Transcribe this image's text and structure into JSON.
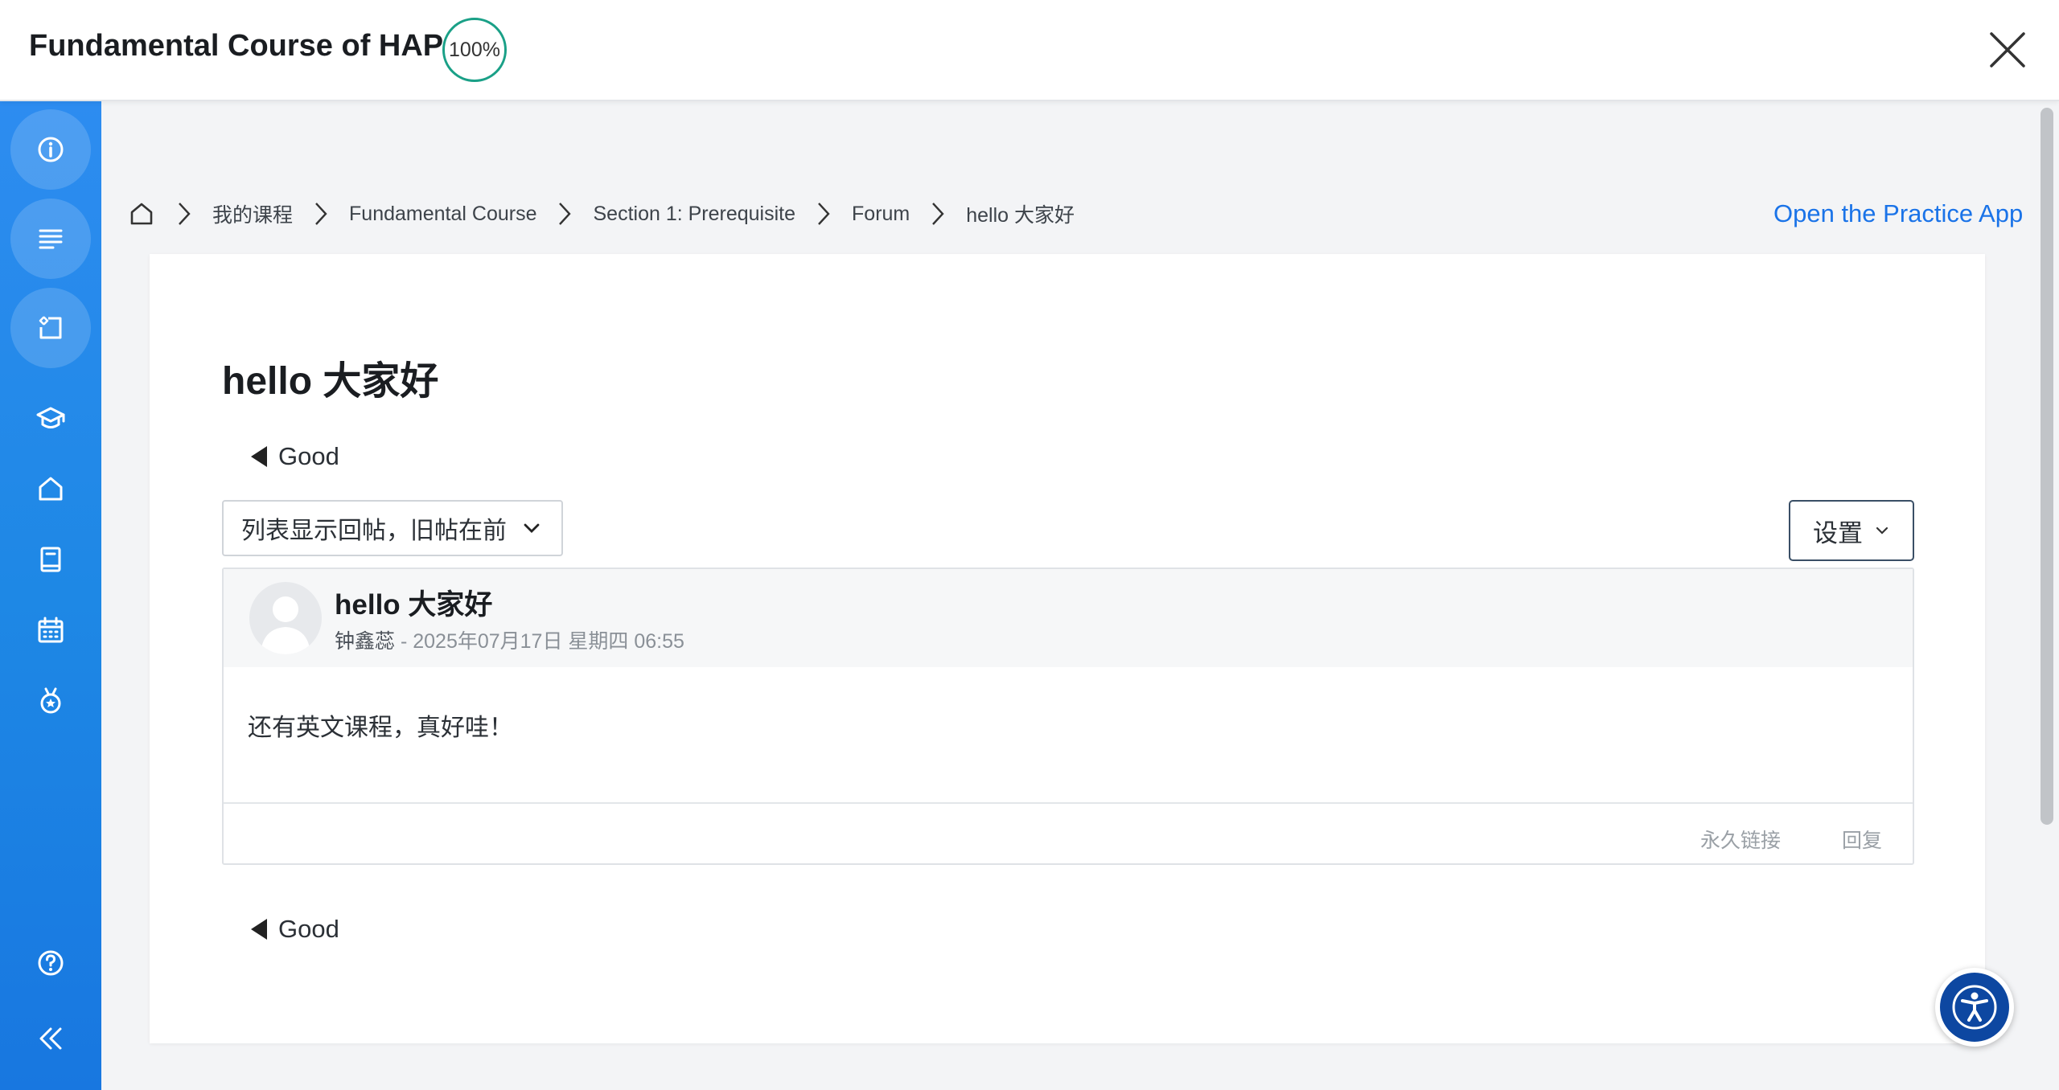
{
  "header": {
    "course_title": "Fundamental Course of HAP",
    "progress": "100%"
  },
  "sidebar": {
    "items": [
      {
        "name": "info"
      },
      {
        "name": "outline"
      },
      {
        "name": "activity"
      },
      {
        "name": "courses"
      },
      {
        "name": "home"
      },
      {
        "name": "book"
      },
      {
        "name": "calendar"
      },
      {
        "name": "badge"
      },
      {
        "name": "help"
      },
      {
        "name": "collapse"
      }
    ]
  },
  "breadcrumb": {
    "items": [
      "我的课程",
      "Fundamental Course",
      "Section 1: Prerequisite",
      "Forum",
      "hello 大家好"
    ]
  },
  "practice_link": "Open the Practice App",
  "discussion": {
    "title": "hello 大家好",
    "prev_label": "Good",
    "next_label": "Good",
    "sort_value": "列表显示回帖，旧帖在前",
    "settings_label": "设置"
  },
  "post": {
    "subject": "hello 大家好",
    "author": "钟鑫蕊",
    "date": " - 2025年07月17日 星期四 06:55",
    "body": "还有英文课程，真好哇！",
    "permalink_label": "永久链接",
    "reply_label": "回复"
  },
  "colors": {
    "accent": "#1a73e8",
    "sidebar": "#1e88e5",
    "progress": "#1aa087",
    "a11y": "#0d47a1"
  }
}
